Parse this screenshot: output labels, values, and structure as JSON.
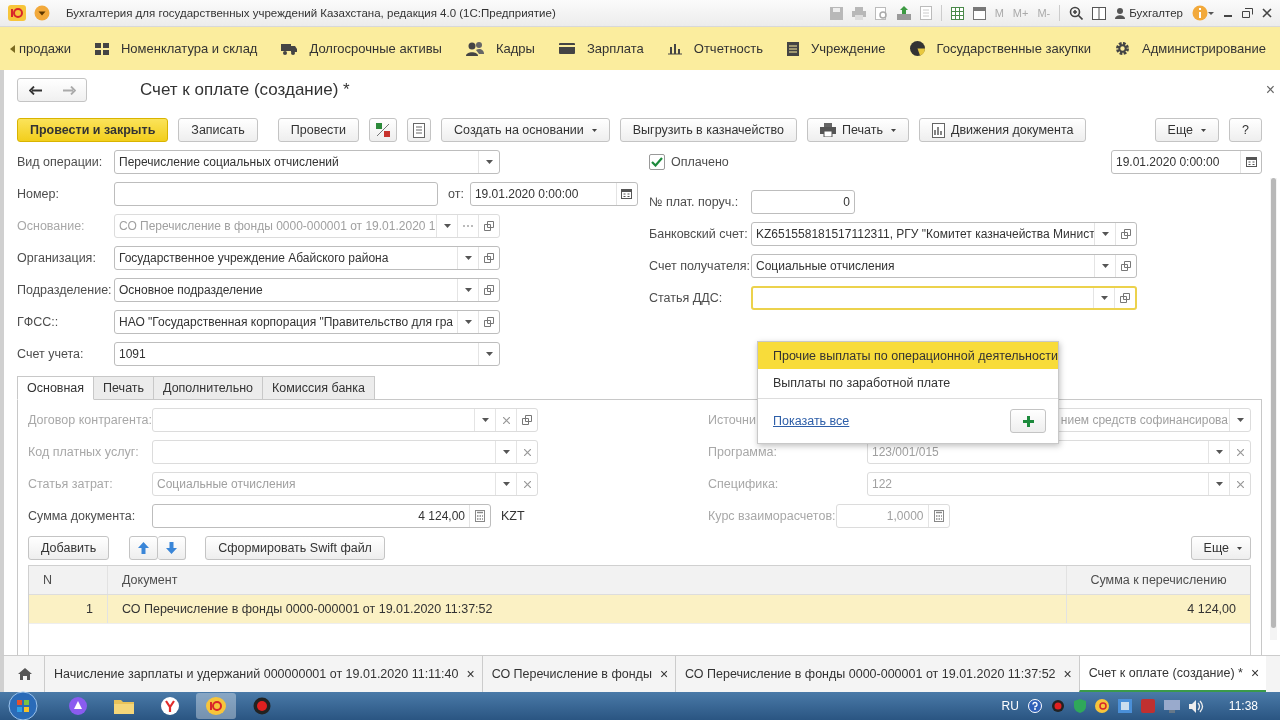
{
  "title_bar": {
    "title": "Бухгалтерия для государственных учреждений Казахстана, редакция 4.0  (1С:Предприятие)",
    "memory_buttons": [
      "M",
      "M+",
      "M-"
    ],
    "user": "Бухгалтер"
  },
  "sections": [
    {
      "label": "продажи"
    },
    {
      "label": "Номенклатура и склад"
    },
    {
      "label": "Долгосрочные активы"
    },
    {
      "label": "Кадры"
    },
    {
      "label": "Зарплата"
    },
    {
      "label": "Отчетность"
    },
    {
      "label": "Учреждение"
    },
    {
      "label": "Государственные закупки"
    },
    {
      "label": "Администрирование"
    }
  ],
  "form": {
    "title": "Счет к оплате (создание) *",
    "close": "×"
  },
  "commands": [
    {
      "label": "Провести и закрыть",
      "kind": "primary"
    },
    {
      "label": "Записать",
      "kind": "button"
    },
    {
      "label": "Провести",
      "kind": "button"
    },
    {
      "kind": "icon"
    },
    {
      "kind": "icon"
    },
    {
      "label": "Создать на основании",
      "kind": "menu"
    },
    {
      "label": "Выгрузить в казначейство",
      "kind": "button"
    },
    {
      "label": "Печать",
      "kind": "menu"
    },
    {
      "label": "Движения документа",
      "kind": "button"
    },
    {
      "label": "Еще",
      "kind": "menu"
    },
    {
      "label": "?",
      "kind": "button"
    }
  ],
  "fields_left": [
    {
      "label": "Вид операции:",
      "value": "Перечисление социальных отчислений",
      "kind": "text",
      "disabled": false,
      "buttons": [
        {
          "kind": "dropdown"
        }
      ]
    },
    {
      "label": "Номер:",
      "kind": "text",
      "disabled": false,
      "date": {
        "label": "от:",
        "value": "19.01.2020  0:00:00"
      }
    },
    {
      "label": "Основание:",
      "value": "СО Перечисление в фонды 0000-000001 от 19.01.2020 1",
      "kind": "text",
      "disabled": true,
      "buttons": [
        {
          "kind": "dropdown"
        },
        {
          "kind": "ellipsis"
        },
        {
          "kind": "open"
        }
      ]
    },
    {
      "label": "Организация:",
      "value": "Государственное учреждение Абайского района",
      "kind": "text",
      "disabled": false,
      "buttons": [
        {
          "kind": "dropdown"
        },
        {
          "kind": "open"
        }
      ]
    },
    {
      "label": "Подразделение:",
      "value": "Основное подразделение",
      "kind": "text",
      "disabled": false,
      "buttons": [
        {
          "kind": "dropdown"
        },
        {
          "kind": "open"
        }
      ]
    },
    {
      "label": "ГФСС::",
      "value": "НАО \"Государственная корпорация \"Правительство для гра",
      "kind": "text",
      "disabled": false,
      "buttons": [
        {
          "kind": "dropdown"
        },
        {
          "kind": "open"
        }
      ]
    },
    {
      "label": "Счет учета:",
      "value": "1091",
      "kind": "text",
      "disabled": false,
      "buttons": [
        {
          "kind": "dropdown"
        }
      ]
    }
  ],
  "paid": {
    "label": "Оплачено",
    "checked": true,
    "date": "19.01.2020  0:00:00"
  },
  "fields_right": [
    {
      "label": "№ плат. поруч.:",
      "value": "0",
      "kind": "number",
      "disabled": false,
      "focused": false
    },
    {
      "label": "Банковский счет:",
      "value": "KZ651558181517112311, РГУ \"Комитет казначейства Минист",
      "kind": "text",
      "disabled": false,
      "focused": false,
      "buttons": [
        {
          "kind": "dropdown"
        },
        {
          "kind": "open"
        }
      ]
    },
    {
      "label": "Счет получателя:",
      "value": "Социальные отчисления",
      "kind": "text",
      "disabled": false,
      "focused": false,
      "buttons": [
        {
          "kind": "dropdown"
        },
        {
          "kind": "open"
        }
      ]
    },
    {
      "label": "Статья ДДС:",
      "kind": "text",
      "disabled": false,
      "focused": true,
      "buttons": [
        {
          "kind": "dropdown"
        },
        {
          "kind": "open"
        }
      ]
    }
  ],
  "tabs": [
    {
      "label": "Основная",
      "selected": true
    },
    {
      "label": "Печать",
      "selected": false
    },
    {
      "label": "Дополнительно",
      "selected": false
    },
    {
      "label": "Комиссия банка",
      "selected": false
    }
  ],
  "panel_left": [
    {
      "label": "Договор контрагента:",
      "kind": "text",
      "disabled": true,
      "buttons": [
        {
          "kind": "dropdown"
        },
        {
          "kind": "clear"
        },
        {
          "kind": "open"
        }
      ]
    },
    {
      "label": "Код платных услуг:",
      "kind": "text",
      "disabled": true,
      "buttons": [
        {
          "kind": "dropdown"
        },
        {
          "kind": "clear"
        }
      ]
    },
    {
      "label": "Статья затрат:",
      "value": "Социальные отчисления",
      "kind": "text",
      "disabled": true,
      "buttons": [
        {
          "kind": "dropdown"
        },
        {
          "kind": "clear"
        }
      ]
    },
    {
      "label": "Сумма документа:",
      "value": "4 124,00",
      "kind": "amount",
      "disabled": false,
      "buttons": [
        {
          "kind": "calc"
        }
      ],
      "currency": "KZT"
    }
  ],
  "panel_right": [
    {
      "label": "Источни",
      "value": "нием средств софинансирова",
      "kind": "clipped",
      "disabled": true,
      "buttons": [
        {
          "kind": "dropdown"
        }
      ]
    },
    {
      "label": "Программа:",
      "value": "123/001/015",
      "kind": "text",
      "disabled": true,
      "buttons": [
        {
          "kind": "dropdown"
        },
        {
          "kind": "clear"
        }
      ]
    },
    {
      "label": "Специфика:",
      "value": "122",
      "kind": "text",
      "disabled": true,
      "buttons": [
        {
          "kind": "dropdown"
        },
        {
          "kind": "clear"
        }
      ]
    },
    {
      "label": "Курс взаиморасчетов:",
      "value": "1,0000",
      "kind": "amount",
      "disabled": true,
      "buttons": [
        {
          "kind": "calc"
        }
      ]
    }
  ],
  "table_buttons": [
    {
      "label": "Добавить",
      "kind": "button"
    },
    {
      "kind": "up"
    },
    {
      "kind": "down"
    },
    {
      "label": "Сформировать Swift файл",
      "kind": "button"
    },
    {
      "label": "Еще",
      "kind": "menu"
    }
  ],
  "table": {
    "columns": [
      "N",
      "Документ",
      "Сумма к перечислению"
    ],
    "rows": [
      {
        "cells": [
          "1",
          "СО Перечисление в фонды 0000-000001 от 19.01.2020 11:37:52",
          "4 124,00"
        ],
        "selected": true
      }
    ]
  },
  "popup": {
    "items": [
      {
        "label": "Прочие выплаты по операционной деятельности",
        "selected": true
      },
      {
        "label": "Выплаты по заработной плате",
        "selected": false
      }
    ],
    "link": "Показать все"
  },
  "window_tabs": [
    {
      "label": "Начисление зарплаты и удержаний 000000001 от 19.01.2020 11:11:40",
      "close": "×",
      "selected": false
    },
    {
      "label": "СО Перечисление в фонды",
      "close": "×",
      "selected": false
    },
    {
      "label": "СО Перечисление в фонды 0000-000001 от 19.01.2020 11:37:52",
      "close": "×",
      "selected": false
    },
    {
      "label": "Счет к оплате (создание) *",
      "close": "×",
      "selected": true
    }
  ],
  "taskbar": {
    "language": "RU",
    "time": "11:38"
  }
}
